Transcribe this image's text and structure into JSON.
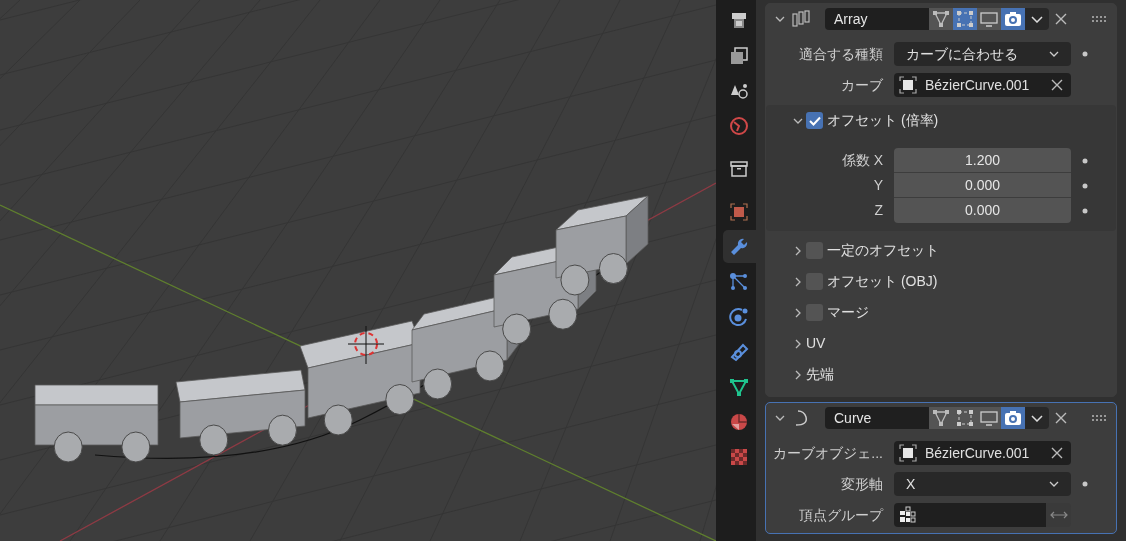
{
  "properties_tabs": [
    {
      "kind": "output",
      "selected": false
    },
    {
      "kind": "view_layer",
      "selected": false
    },
    {
      "kind": "scene",
      "selected": false
    },
    {
      "kind": "world",
      "selected": false
    },
    {
      "kind": "collection",
      "selected": false
    },
    {
      "kind": "object",
      "selected": false
    },
    {
      "kind": "modifiers",
      "selected": true
    },
    {
      "kind": "particles",
      "selected": false
    },
    {
      "kind": "physics",
      "selected": false
    },
    {
      "kind": "constraints",
      "selected": false
    },
    {
      "kind": "data",
      "selected": false
    },
    {
      "kind": "material",
      "selected": false
    },
    {
      "kind": "texture",
      "selected": false
    }
  ],
  "modifiers": [
    {
      "kind": "array",
      "name": "Array",
      "expanded": true,
      "active": false,
      "toggles": [
        {
          "kind": "on_cage",
          "selected": false
        },
        {
          "kind": "edit_mode",
          "selected": true
        },
        {
          "kind": "viewport",
          "selected": false
        },
        {
          "kind": "render",
          "selected": true
        }
      ],
      "fields": [
        {
          "kind": "dropdown",
          "label": "適合する種類",
          "value": "カーブに合わせる"
        },
        {
          "kind": "object",
          "label": "カーブ",
          "value": "BézierCurve.001"
        }
      ],
      "subpanels": [
        {
          "label": "オフセット (倍率)",
          "checked": true,
          "expanded": true,
          "fields": [
            {
              "label": "係数 X",
              "value": "1.200"
            },
            {
              "label": "Y",
              "value": "0.000"
            },
            {
              "label": "Z",
              "value": "0.000"
            }
          ]
        },
        {
          "label": "一定のオフセット",
          "checked": false,
          "expanded": false
        },
        {
          "label": "オフセット (OBJ)",
          "checked": false,
          "expanded": false
        },
        {
          "label": "マージ",
          "checked": false,
          "expanded": false
        },
        {
          "label": "UV",
          "expanded": false
        },
        {
          "label": "先端",
          "expanded": false
        }
      ]
    },
    {
      "kind": "curve",
      "name": "Curve",
      "expanded": true,
      "active": true,
      "toggles": [
        {
          "kind": "on_cage",
          "selected": false
        },
        {
          "kind": "edit_mode",
          "selected": false
        },
        {
          "kind": "viewport",
          "selected": false
        },
        {
          "kind": "render",
          "selected": true
        }
      ],
      "fields": [
        {
          "kind": "object",
          "label": "カーブオブジェ...",
          "value": "BézierCurve.001"
        },
        {
          "kind": "dropdown",
          "label": "変形軸",
          "value": "X"
        },
        {
          "kind": "vertex_group",
          "label": "頂点グループ"
        }
      ]
    }
  ]
}
